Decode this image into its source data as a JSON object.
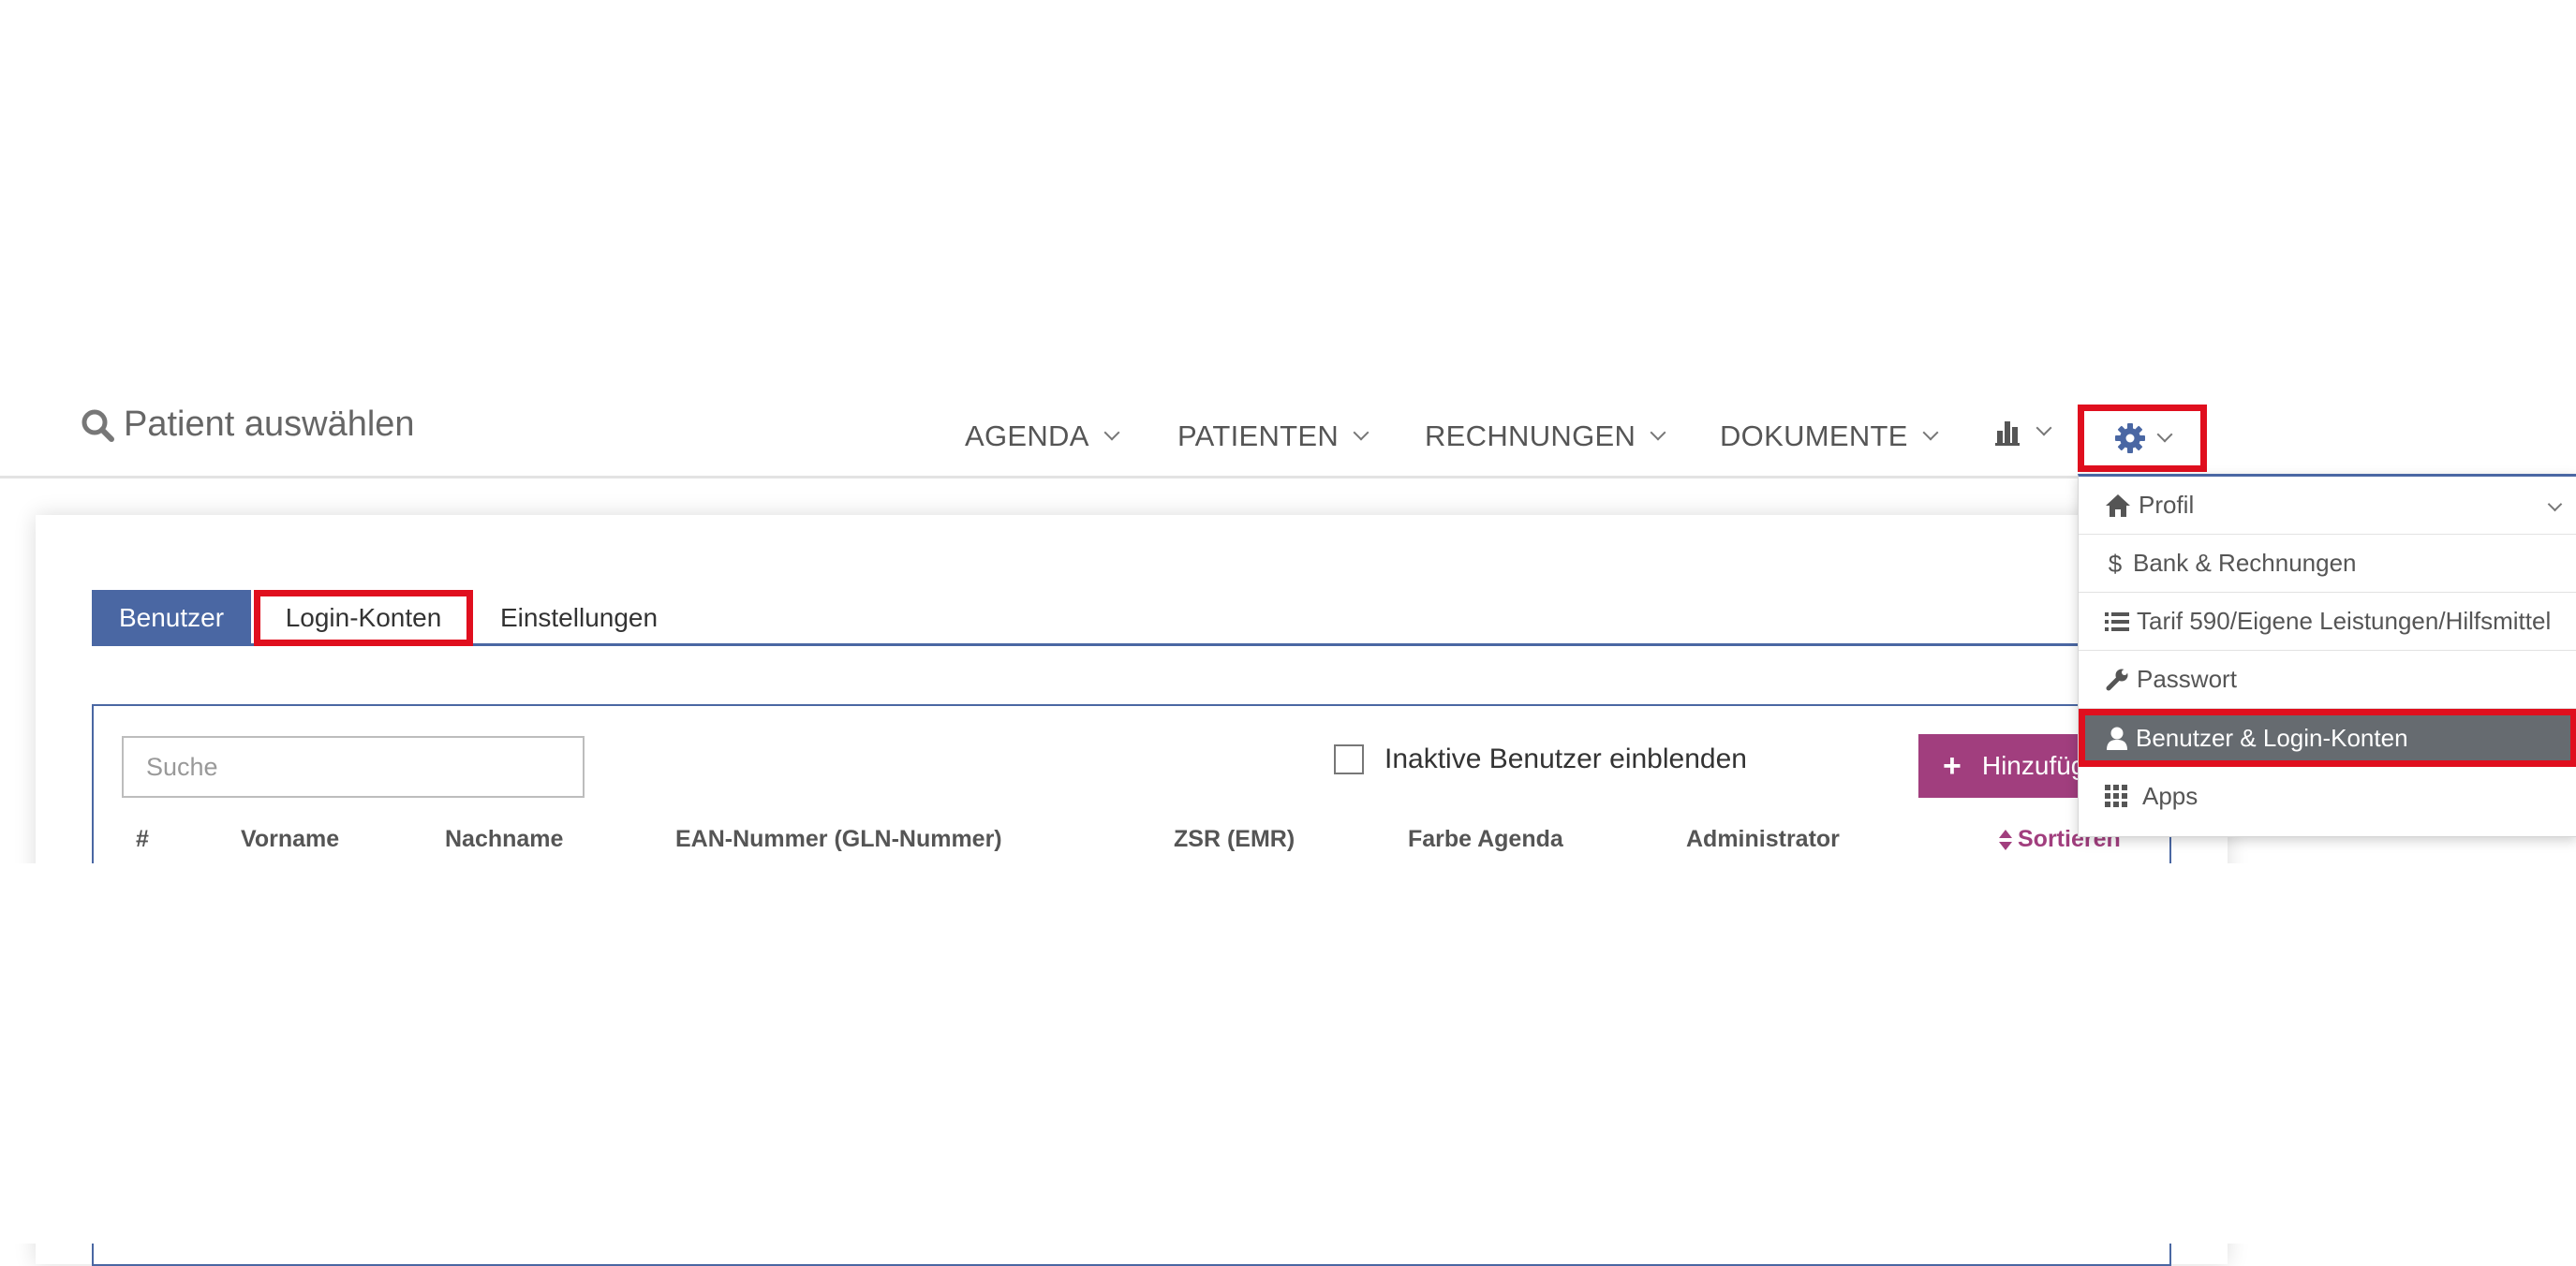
{
  "header": {
    "patient_select": "Patient auswählen",
    "nav": [
      {
        "label": "AGENDA"
      },
      {
        "label": "PATIENTEN"
      },
      {
        "label": "RECHNUNGEN"
      },
      {
        "label": "DOKUMENTE"
      }
    ],
    "stats_icon": "bar-chart-icon",
    "settings_icon": "gear-icon"
  },
  "tabs": [
    {
      "label": "Benutzer",
      "active": true
    },
    {
      "label": "Login-Konten"
    },
    {
      "label": "Einstellungen"
    }
  ],
  "toolbar": {
    "search_placeholder": "Suche",
    "show_inactive_label": "Inaktive Benutzer einblenden",
    "add_label": "Hinzufügen"
  },
  "table": {
    "columns": [
      "#",
      "Vorname",
      "Nachname",
      "EAN-Nummer (GLN-Nummer)",
      "ZSR (EMR)",
      "Farbe Agenda",
      "Administrator",
      "Sortieren"
    ]
  },
  "settings_menu": {
    "items": [
      {
        "label": "Profil",
        "icon": "home-icon"
      },
      {
        "label": "Bank & Rechnungen",
        "icon": "dollar-icon"
      },
      {
        "label": "Tarif 590/Eigene Leistungen/Hilfsmittel",
        "icon": "list-icon"
      },
      {
        "label": "Passwort",
        "icon": "wrench-icon"
      },
      {
        "label": "Benutzer & Login-Konten",
        "icon": "user-icon",
        "active": true
      },
      {
        "label": "Apps",
        "icon": "apps-grid-icon"
      }
    ]
  },
  "colors": {
    "primary": "#4a67a3",
    "accent": "#a13e7e",
    "highlight": "#e00f1e",
    "menu_active_bg": "#666b70"
  }
}
